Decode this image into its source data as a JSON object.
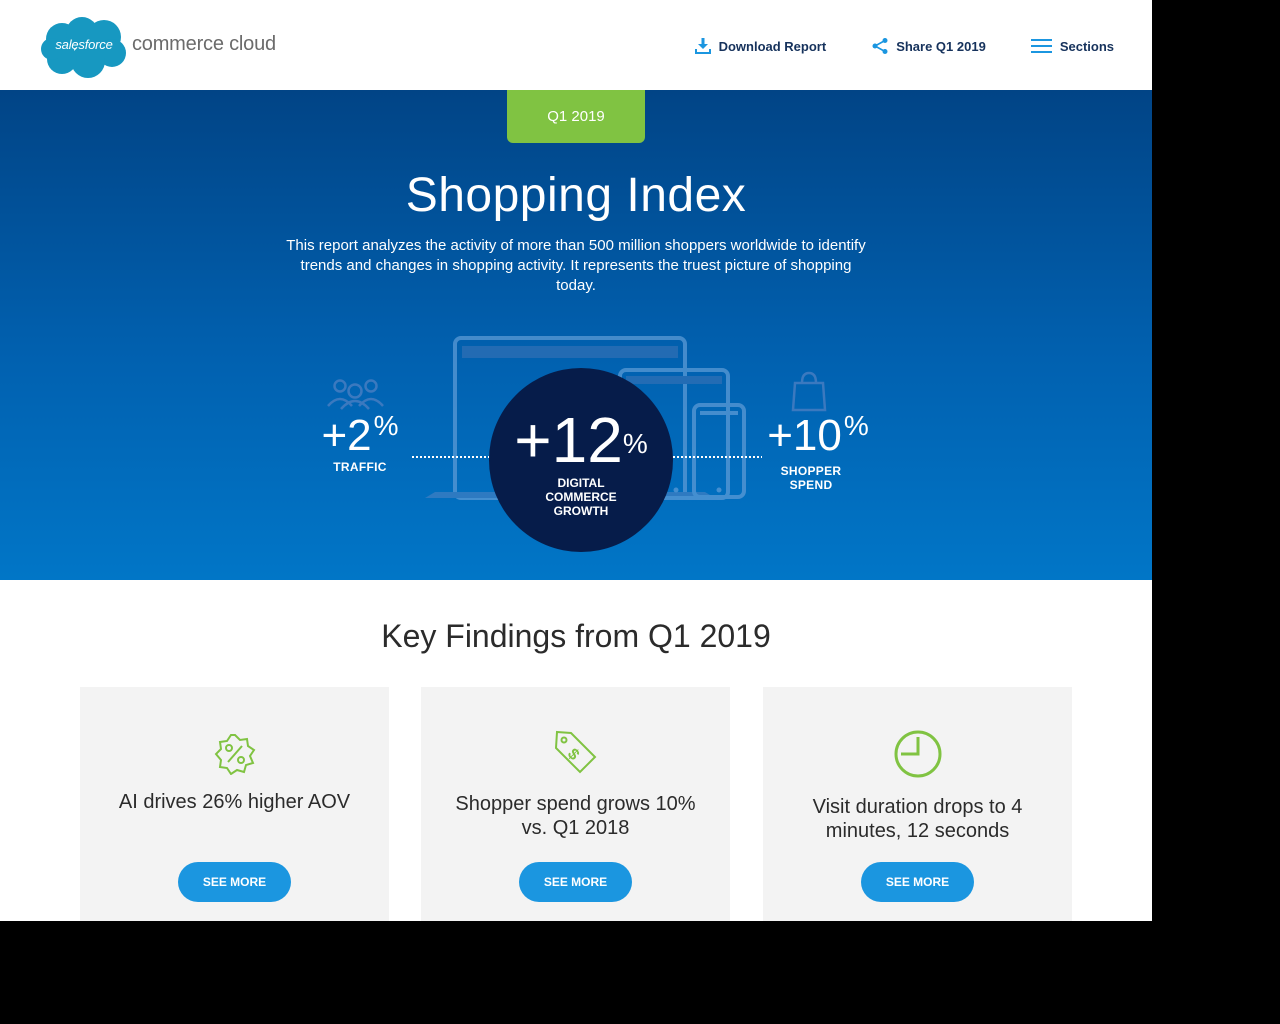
{
  "header": {
    "logo_cloud_text": "salesforce",
    "logo_sub_text": "commerce cloud",
    "nav": [
      {
        "label": "Download Report",
        "icon": "download-icon"
      },
      {
        "label": "Share Q1 2019",
        "icon": "share-icon"
      },
      {
        "label": "Sections",
        "icon": "hamburger-menu-icon"
      }
    ]
  },
  "hero": {
    "badge": "Q1 2019",
    "title": "Shopping Index",
    "description": "This report analyzes the activity of more than 500 million shoppers worldwide to identify trends and changes in shopping activity. It represents the truest picture of shopping today.",
    "stats": {
      "traffic": {
        "value": "+2",
        "unit": "%",
        "label": "TRAFFIC",
        "icon": "people-icon"
      },
      "growth": {
        "value": "+12",
        "unit": "%",
        "label_lines": [
          "DIGITAL",
          "COMMERCE",
          "GROWTH"
        ]
      },
      "spend": {
        "value": "+10",
        "unit": "%",
        "label_lines": [
          "SHOPPER",
          "SPEND"
        ],
        "icon": "shopping-bag-icon"
      }
    },
    "colors": {
      "badge": "#80c342",
      "circle": "#061c4a",
      "gradient_top": "#014486",
      "gradient_bottom": "#0176c7"
    }
  },
  "key_findings": {
    "title": "Key Findings from Q1 2019",
    "cards": [
      {
        "text": "AI drives 26% higher AOV",
        "button": "SEE MORE",
        "icon": "percent-badge-icon"
      },
      {
        "text": "Shopper spend grows 10% vs. Q1 2018",
        "button": "SEE MORE",
        "icon": "price-tag-icon"
      },
      {
        "text": "Visit duration drops to 4 minutes, 12 seconds",
        "button": "SEE MORE",
        "icon": "clock-icon"
      }
    ],
    "colors": {
      "icon": "#80c342",
      "button": "#1b96e0"
    }
  }
}
